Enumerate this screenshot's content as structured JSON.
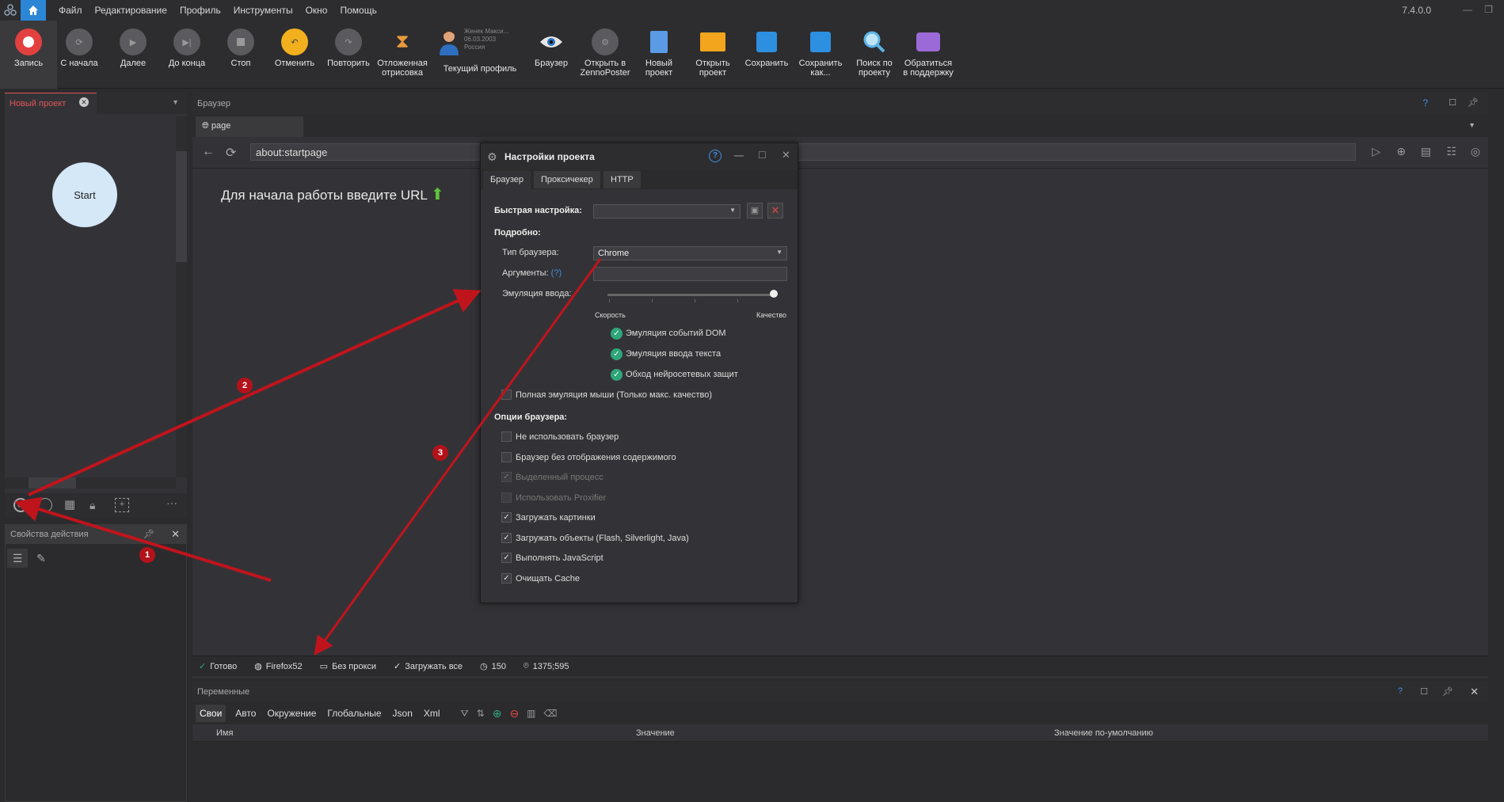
{
  "menubar": {
    "items": [
      "Файл",
      "Редактирование",
      "Профиль",
      "Инструменты",
      "Окно",
      "Помощь"
    ],
    "version": "7.4.0.0"
  },
  "toolbar": {
    "record": "Запись",
    "from_start": "С начала",
    "next": "Далее",
    "to_end": "До конца",
    "stop": "Стоп",
    "undo": "Отменить",
    "redo": "Повторить",
    "deferred_render": [
      "Отложенная",
      "отрисовка"
    ],
    "current_profile": "Текущий профиль",
    "profile_info": [
      "Женек Макси...",
      "06.03.2003",
      "Россия"
    ],
    "browser": "Браузер",
    "open_in_zenno": [
      "Открыть в",
      "ZennoPoster"
    ],
    "new_project": [
      "Новый",
      "проект"
    ],
    "open_project": [
      "Открыть",
      "проект"
    ],
    "save": "Сохранить",
    "save_as": [
      "Сохранить",
      "как..."
    ],
    "search_project": [
      "Поиск по",
      "проекту"
    ],
    "support": [
      "Обратиться",
      "в поддержку"
    ]
  },
  "project": {
    "tab": "Новый проект",
    "start_node": "Start"
  },
  "props": {
    "title": "Свойства действия"
  },
  "browser": {
    "title": "Браузер",
    "tab": "page",
    "url": "about:startpage",
    "hint": "Для начала работы введите URL"
  },
  "status": {
    "ready": "Готово",
    "engine": "Firefox52",
    "proxy": "Без прокси",
    "load": "Загружать все",
    "count": "150",
    "coords": "1375;595"
  },
  "variables": {
    "title": "Переменные",
    "tabs": [
      "Свои",
      "Авто",
      "Окружение",
      "Глобальные",
      "Json",
      "Xml"
    ],
    "columns": [
      "Имя",
      "Значение",
      "Значение по-умолчанию"
    ]
  },
  "dialog": {
    "title": "Настройки проекта",
    "tabs": [
      "Браузер",
      "Проксичекер",
      "HTTP"
    ],
    "quick_setup": "Быстрая настройка:",
    "detailed": "Подробно:",
    "browser_type_label": "Тип браузера:",
    "browser_type_value": "Chrome",
    "arguments_label": "Аргументы:",
    "arguments_help": "(?)",
    "input_emulation_label": "Эмуляция ввода:",
    "input_emulation_level": 1.0,
    "speed": "Скорость",
    "quality": "Качество",
    "dom_events": "Эмуляция событий DOM",
    "text_input": "Эмуляция ввода текста",
    "bypass_nn": "Обход нейросетевых защит",
    "full_mouse": "Полная эмуляция мыши (Только макс. качество)",
    "browser_options": "Опции браузера:",
    "options": [
      {
        "label": "Не использовать браузер",
        "checked": false,
        "disabled": false
      },
      {
        "label": "Браузер без отображения содержимого",
        "checked": false,
        "disabled": false
      },
      {
        "label": "Выделенный процесс",
        "checked": true,
        "disabled": true
      },
      {
        "label": "Использовать Proxifier",
        "checked": false,
        "disabled": true
      },
      {
        "label": "Загружать картинки",
        "checked": true,
        "disabled": false
      },
      {
        "label": "Загружать объекты (Flash, Silverlight, Java)",
        "checked": true,
        "disabled": false
      },
      {
        "label": "Выполнять JavaScript",
        "checked": true,
        "disabled": false
      },
      {
        "label": "Очищать Cache",
        "checked": true,
        "disabled": false
      }
    ]
  },
  "annotations": {
    "badge1": "1",
    "badge2": "2",
    "badge3": "3",
    "arrow_color": "#c0141c"
  }
}
